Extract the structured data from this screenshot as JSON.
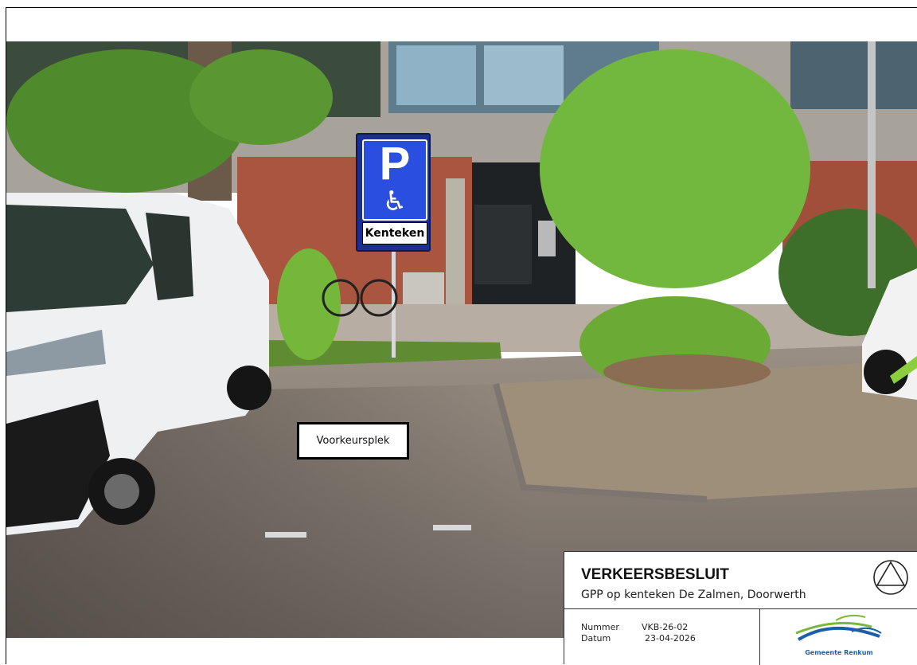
{
  "sign": {
    "symbol": "P",
    "pictogram": "wheelchair-icon",
    "plate_text": "Kenteken"
  },
  "callout": {
    "label": "Voorkeursplek"
  },
  "title_block": {
    "title": "VERKEERSBESLUIT",
    "subtitle": "GPP op kenteken De Zalmen, Doorwerth",
    "number_label": "Nummer",
    "number_value": "VKB-26-02",
    "date_label": "Datum",
    "date_value": "23-04-2026",
    "logo_text": "Gemeente Renkum",
    "symbol_icon": "triangle-in-circle-icon"
  },
  "colors": {
    "sign_blue": "#2a4fe0",
    "logo_blue": "#1a5fa8",
    "logo_green": "#7ab83c"
  }
}
